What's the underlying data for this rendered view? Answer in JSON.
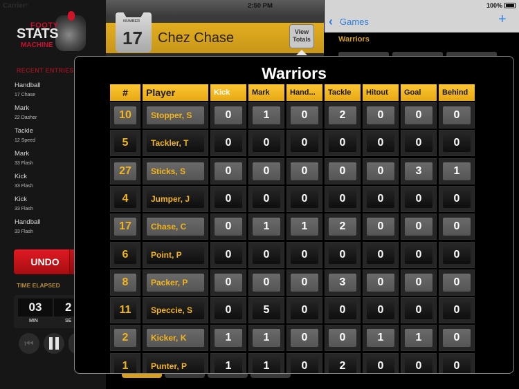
{
  "status_bar": {
    "carrier": "Carrier",
    "time": "2:50 PM",
    "battery": "100%"
  },
  "sidebar": {
    "logo": {
      "line1": "FOOTY",
      "line2": "STATS",
      "line3": "MACHINE"
    },
    "recent_title": "RECENT ENTRIES",
    "entries": [
      {
        "action": "Handball",
        "player": "17  Chase"
      },
      {
        "action": "Mark",
        "player": "22  Dasher"
      },
      {
        "action": "Tackle",
        "player": "12  Speed"
      },
      {
        "action": "Mark",
        "player": "33  Flash"
      },
      {
        "action": "Kick",
        "player": "33  Flash"
      },
      {
        "action": "Kick",
        "player": "33  Flash"
      },
      {
        "action": "Handball",
        "player": "33  Flash"
      }
    ],
    "undo_label": "UNDO",
    "time_title": "TIME ELAPSED",
    "timer": {
      "min": "03",
      "sec": "2",
      "min_label": "MIN",
      "sec_label": "SE"
    }
  },
  "player_header": {
    "number_label": "NUMBER",
    "number": "17",
    "name": "Chez Chase",
    "view_totals_line1": "View",
    "view_totals_line2": "Totals"
  },
  "right_nav": {
    "back_label": "Games",
    "add_icon": "+",
    "team": "Warriors"
  },
  "modal": {
    "title": "Warriors",
    "columns": [
      "#",
      "Player",
      "Kick",
      "Mark",
      "Hand...",
      "Tackle",
      "Hitout",
      "Goal",
      "Behind"
    ],
    "rows": [
      {
        "num": "10",
        "name": "Stopper, S",
        "stats": [
          "0",
          "1",
          "0",
          "2",
          "0",
          "0",
          "0"
        ]
      },
      {
        "num": "5",
        "name": "Tackler, T",
        "stats": [
          "0",
          "0",
          "0",
          "0",
          "0",
          "0",
          "0"
        ]
      },
      {
        "num": "27",
        "name": "Sticks, S",
        "stats": [
          "0",
          "0",
          "0",
          "0",
          "0",
          "3",
          "1"
        ]
      },
      {
        "num": "4",
        "name": "Jumper, J",
        "stats": [
          "0",
          "0",
          "0",
          "0",
          "0",
          "0",
          "0"
        ]
      },
      {
        "num": "17",
        "name": "Chase, C",
        "stats": [
          "0",
          "1",
          "1",
          "2",
          "0",
          "0",
          "0"
        ]
      },
      {
        "num": "6",
        "name": "Point, P",
        "stats": [
          "0",
          "0",
          "0",
          "0",
          "0",
          "0",
          "0"
        ]
      },
      {
        "num": "8",
        "name": "Packer, P",
        "stats": [
          "0",
          "0",
          "0",
          "3",
          "0",
          "0",
          "0"
        ]
      },
      {
        "num": "11",
        "name": "Speccie, S",
        "stats": [
          "0",
          "5",
          "0",
          "0",
          "0",
          "0",
          "0"
        ]
      },
      {
        "num": "2",
        "name": "Kicker, K",
        "stats": [
          "1",
          "1",
          "0",
          "0",
          "1",
          "1",
          "0"
        ]
      },
      {
        "num": "1",
        "name": "Punter, P",
        "stats": [
          "1",
          "1",
          "0",
          "2",
          "0",
          "0",
          "0"
        ]
      }
    ]
  }
}
